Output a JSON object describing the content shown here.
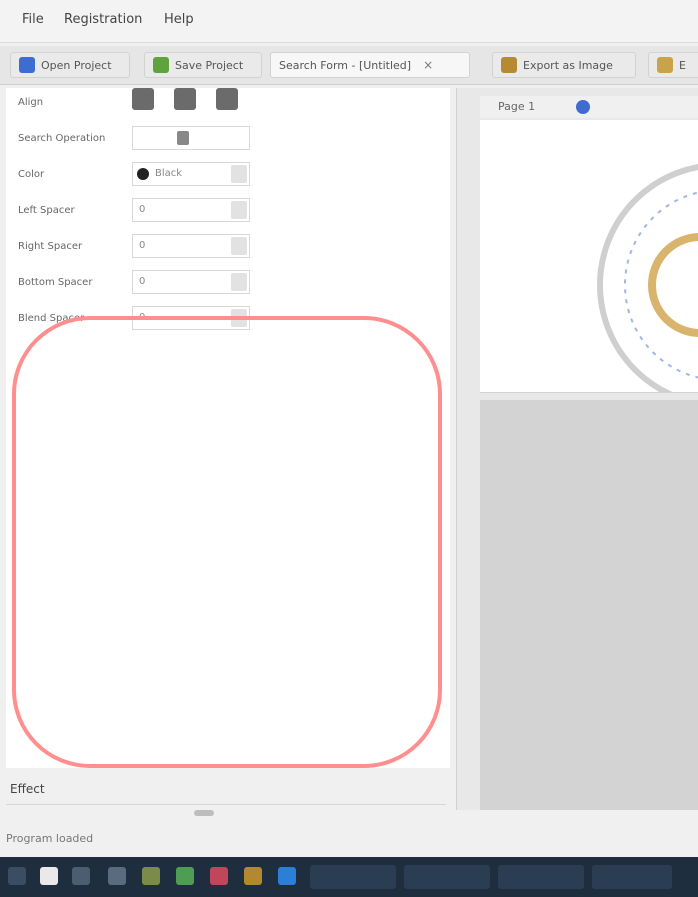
{
  "menubar": {
    "items": [
      "File",
      "Registration",
      "Help"
    ]
  },
  "tabs": [
    {
      "label": "Open Project"
    },
    {
      "label": "Save Project"
    },
    {
      "label": "Search Form - [Untitled]",
      "close": "×"
    },
    {
      "label": "Export as Image"
    },
    {
      "label": "E"
    }
  ],
  "properties": {
    "rows": [
      {
        "label": "Align",
        "value": ""
      },
      {
        "label": "Search Operation",
        "value": ""
      },
      {
        "label": "Color",
        "value": "Black"
      },
      {
        "label": "Left Spacer",
        "value": "0"
      },
      {
        "label": "Right Spacer",
        "value": "0"
      },
      {
        "label": "Bottom Spacer",
        "value": "0"
      },
      {
        "label": "Blend Spacer",
        "value": "0"
      }
    ]
  },
  "effects": {
    "label": "Effect"
  },
  "status": {
    "text": "Program loaded"
  },
  "preview": {
    "page_label": "Page 1",
    "zoom": "1"
  },
  "colors": {
    "highlight": "#ff8f8f",
    "taskbar": "#1f2e3f",
    "accent": "#3f6ccf"
  }
}
